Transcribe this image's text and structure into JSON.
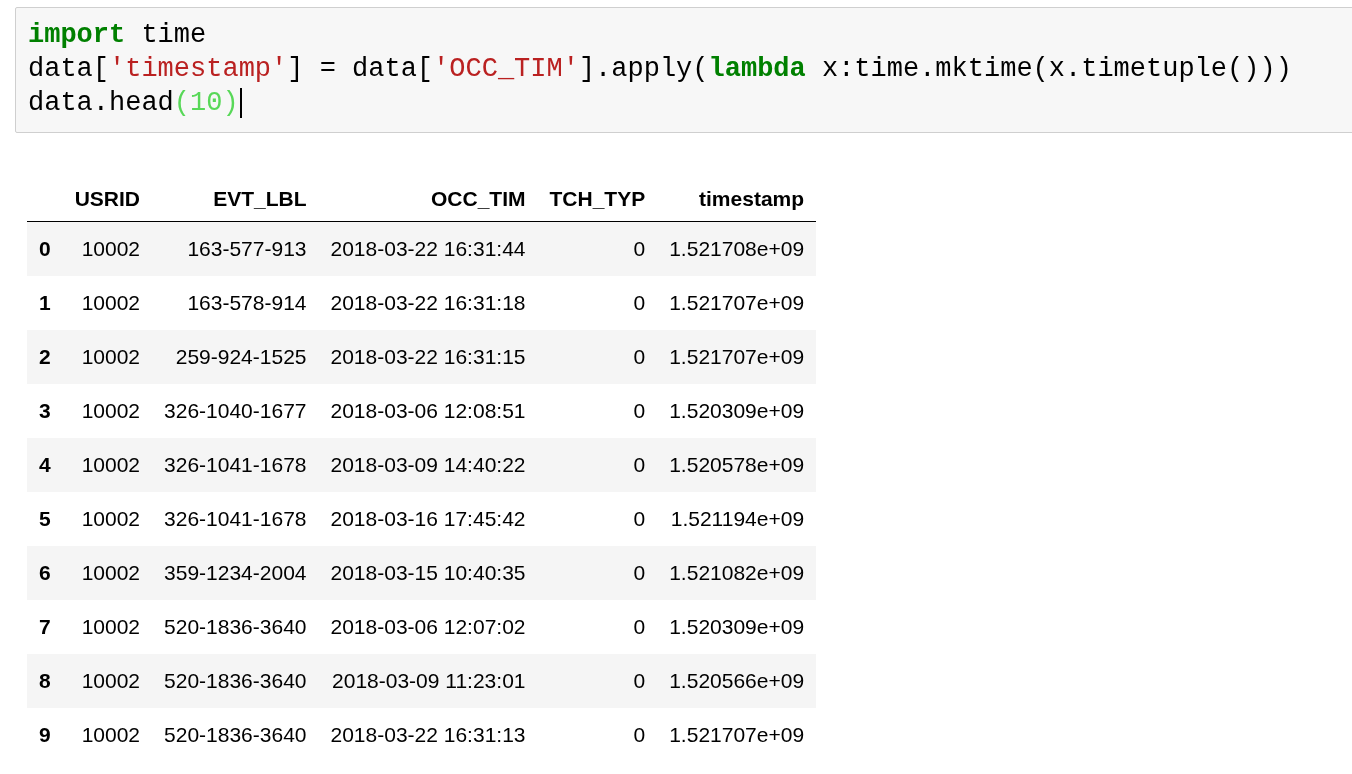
{
  "code_cell": {
    "lines": [
      {
        "has_cursor": false,
        "tokens": [
          {
            "kind": "keyword",
            "text": "import"
          },
          {
            "kind": "plain",
            "text": " time"
          }
        ]
      },
      {
        "has_cursor": false,
        "tokens": [
          {
            "kind": "plain",
            "text": "data["
          },
          {
            "kind": "string",
            "text": "'timestamp'"
          },
          {
            "kind": "plain",
            "text": "] = data["
          },
          {
            "kind": "string",
            "text": "'OCC_TIM'"
          },
          {
            "kind": "plain",
            "text": "].apply("
          },
          {
            "kind": "keyword",
            "text": "lambda"
          },
          {
            "kind": "plain",
            "text": " x:time.mktime(x.timetuple()))"
          }
        ]
      },
      {
        "has_cursor": true,
        "tokens": [
          {
            "kind": "plain",
            "text": "data.head"
          },
          {
            "kind": "match",
            "text": "(10)"
          }
        ]
      }
    ]
  },
  "table": {
    "columns": [
      "USRID",
      "EVT_LBL",
      "OCC_TIM",
      "TCH_TYP",
      "timestamp"
    ],
    "rows": [
      {
        "index": "0",
        "cells": [
          "10002",
          "163-577-913",
          "2018-03-22 16:31:44",
          "0",
          "1.521708e+09"
        ]
      },
      {
        "index": "1",
        "cells": [
          "10002",
          "163-578-914",
          "2018-03-22 16:31:18",
          "0",
          "1.521707e+09"
        ]
      },
      {
        "index": "2",
        "cells": [
          "10002",
          "259-924-1525",
          "2018-03-22 16:31:15",
          "0",
          "1.521707e+09"
        ]
      },
      {
        "index": "3",
        "cells": [
          "10002",
          "326-1040-1677",
          "2018-03-06 12:08:51",
          "0",
          "1.520309e+09"
        ]
      },
      {
        "index": "4",
        "cells": [
          "10002",
          "326-1041-1678",
          "2018-03-09 14:40:22",
          "0",
          "1.520578e+09"
        ]
      },
      {
        "index": "5",
        "cells": [
          "10002",
          "326-1041-1678",
          "2018-03-16 17:45:42",
          "0",
          "1.521194e+09"
        ]
      },
      {
        "index": "6",
        "cells": [
          "10002",
          "359-1234-2004",
          "2018-03-15 10:40:35",
          "0",
          "1.521082e+09"
        ]
      },
      {
        "index": "7",
        "cells": [
          "10002",
          "520-1836-3640",
          "2018-03-06 12:07:02",
          "0",
          "1.520309e+09"
        ]
      },
      {
        "index": "8",
        "cells": [
          "10002",
          "520-1836-3640",
          "2018-03-09 11:23:01",
          "0",
          "1.520566e+09"
        ]
      },
      {
        "index": "9",
        "cells": [
          "10002",
          "520-1836-3640",
          "2018-03-22 16:31:13",
          "0",
          "1.521707e+09"
        ]
      }
    ]
  }
}
